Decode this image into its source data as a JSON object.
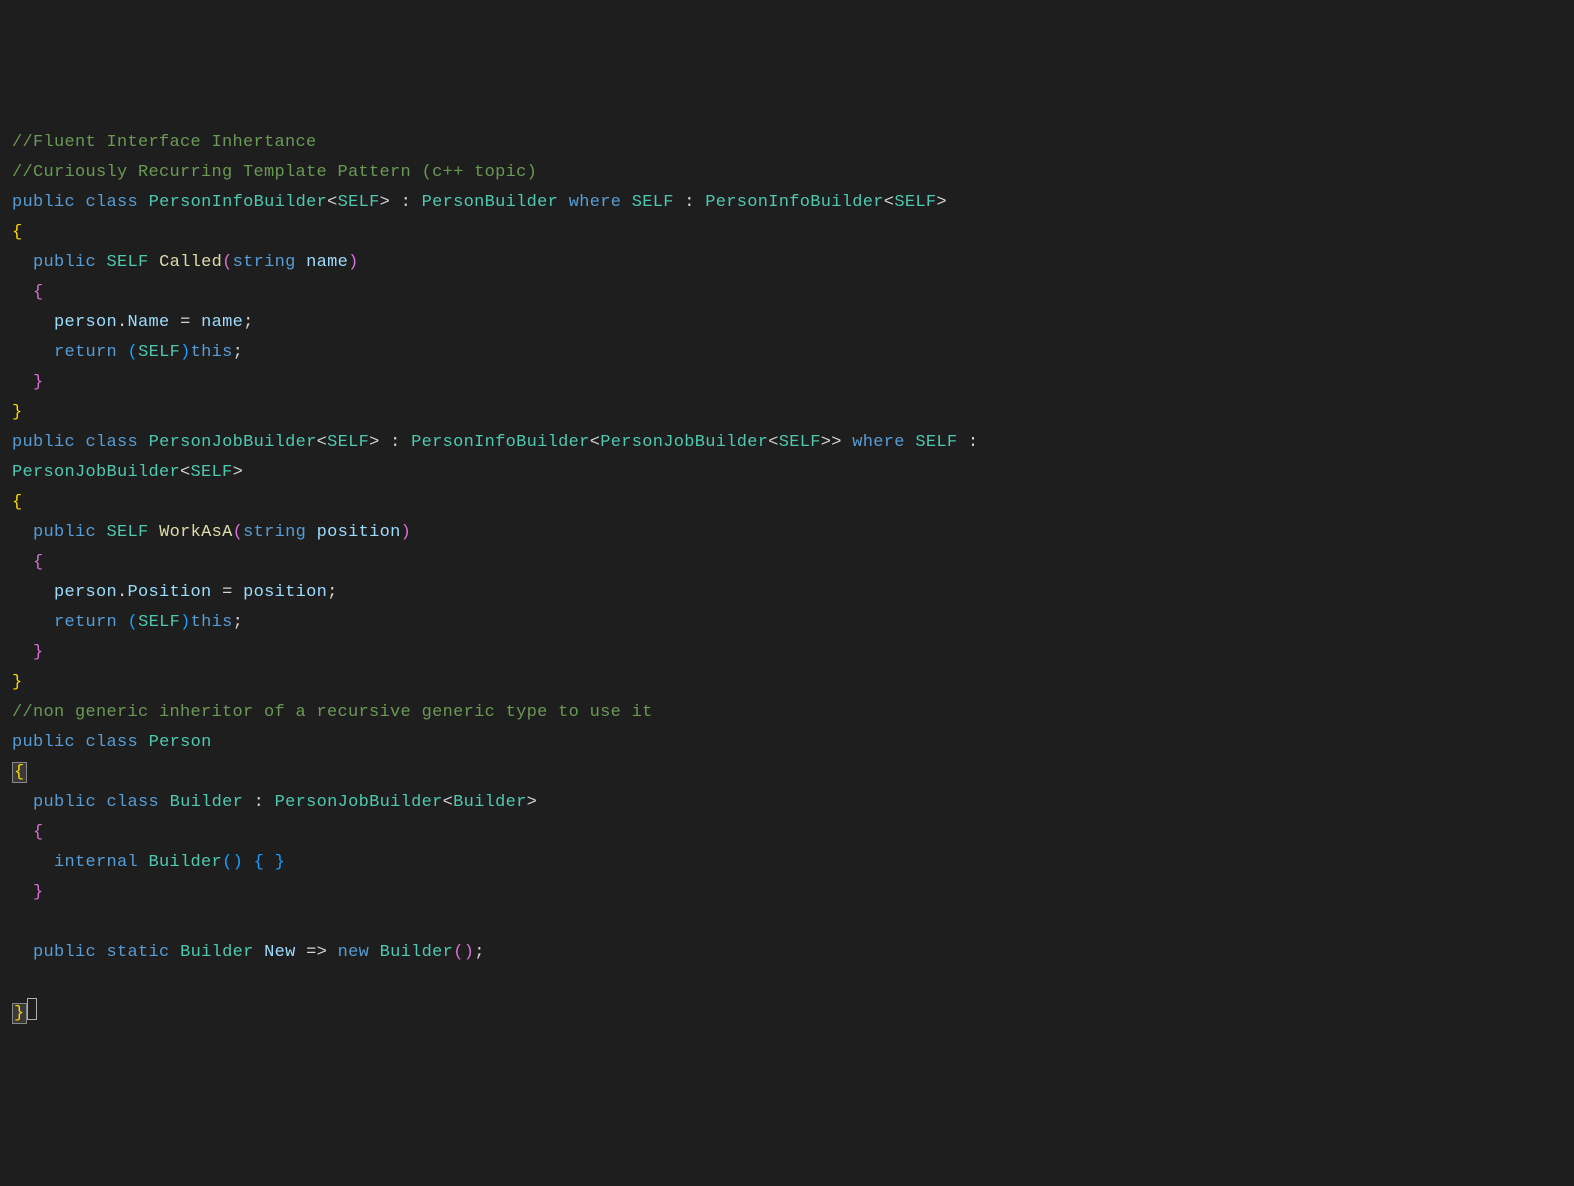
{
  "code": {
    "line1": "//Fluent Interface Inhertance",
    "line2": "//Curiously Recurring Template Pattern (c++ topic)",
    "kw_public": "public",
    "kw_class": "class",
    "kw_where": "where",
    "kw_return": "return",
    "kw_this": "this",
    "kw_string": "string",
    "kw_internal": "internal",
    "kw_static": "static",
    "kw_new": "new",
    "type_PersonInfoBuilder": "PersonInfoBuilder",
    "type_PersonBuilder": "PersonBuilder",
    "type_SELF": "SELF",
    "type_PersonJobBuilder": "PersonJobBuilder",
    "type_Person": "Person",
    "type_Builder": "Builder",
    "fn_Called": "Called",
    "fn_WorkAsA": "WorkAsA",
    "param_name": "name",
    "param_position": "position",
    "prop_Name": "Name",
    "prop_Position": "Position",
    "prop_New": "New",
    "field_person": "person",
    "op_assign": " = ",
    "op_arrow": " => ",
    "op_colon": " : ",
    "semi": ";",
    "lbrace": "{",
    "rbrace": "}",
    "lparen": "(",
    "rparen": ")",
    "lt": "<",
    "gt": ">",
    "gtgt": ">>",
    "comment3": "//non generic inheritor of a recursive generic type to use it",
    "indent1": "  ",
    "indent2": "    "
  }
}
